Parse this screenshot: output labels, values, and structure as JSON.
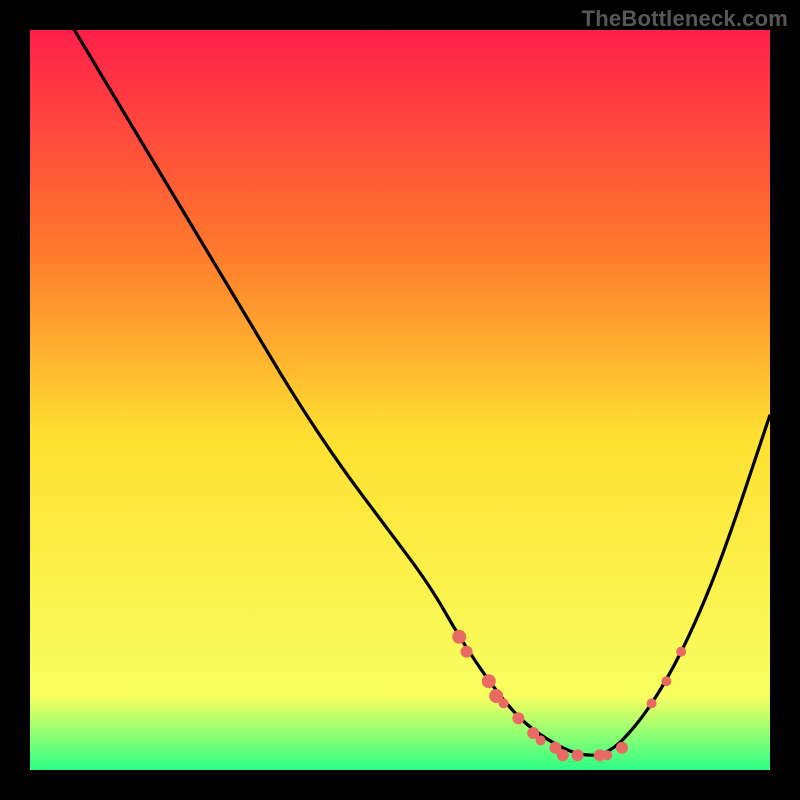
{
  "watermark": "TheBottleneck.com",
  "colors": {
    "background": "#000000",
    "gradient_top": "#ff1f4a",
    "gradient_mid1": "#ff7a2c",
    "gradient_mid2": "#ffe031",
    "gradient_low": "#f8ff60",
    "gradient_bottom": "#2dff86",
    "curve": "#000000",
    "marker": "#e86a63",
    "watermark": "#575757"
  },
  "chart_data": {
    "type": "line",
    "title": "",
    "xlabel": "",
    "ylabel": "",
    "xlim": [
      0,
      100
    ],
    "ylim": [
      0,
      100
    ],
    "series": [
      {
        "name": "bottleneck-curve",
        "x": [
          0,
          6,
          12,
          18,
          24,
          30,
          36,
          42,
          48,
          54,
          58,
          62,
          66,
          70,
          74,
          78,
          82,
          86,
          90,
          94,
          100
        ],
        "y": [
          110,
          100,
          90,
          80,
          70,
          60,
          50,
          41,
          33,
          25,
          18,
          12,
          7,
          4,
          2,
          2,
          6,
          12,
          20,
          30,
          48
        ]
      }
    ],
    "markers": [
      {
        "x": 58,
        "y": 18,
        "r": 7
      },
      {
        "x": 59,
        "y": 16,
        "r": 6
      },
      {
        "x": 62,
        "y": 12,
        "r": 7
      },
      {
        "x": 63,
        "y": 10,
        "r": 7
      },
      {
        "x": 64,
        "y": 9,
        "r": 5
      },
      {
        "x": 66,
        "y": 7,
        "r": 6
      },
      {
        "x": 68,
        "y": 5,
        "r": 6
      },
      {
        "x": 69,
        "y": 4,
        "r": 5
      },
      {
        "x": 71,
        "y": 3,
        "r": 6
      },
      {
        "x": 72,
        "y": 2,
        "r": 6
      },
      {
        "x": 74,
        "y": 2,
        "r": 6
      },
      {
        "x": 77,
        "y": 2,
        "r": 6
      },
      {
        "x": 78,
        "y": 2,
        "r": 5
      },
      {
        "x": 80,
        "y": 3,
        "r": 6
      },
      {
        "x": 84,
        "y": 9,
        "r": 5
      },
      {
        "x": 86,
        "y": 12,
        "r": 5
      },
      {
        "x": 88,
        "y": 16,
        "r": 5
      }
    ]
  }
}
